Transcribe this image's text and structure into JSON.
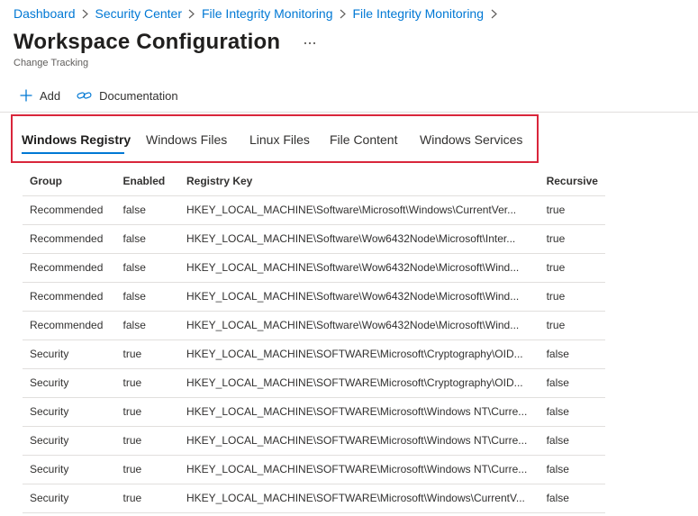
{
  "breadcrumb": [
    "Dashboard",
    "Security Center",
    "File Integrity Monitoring",
    "File Integrity Monitoring"
  ],
  "header": {
    "title": "Workspace Configuration",
    "more_label": "...",
    "subtitle": "Change Tracking"
  },
  "toolbar": {
    "add_label": "Add",
    "documentation_label": "Documentation"
  },
  "tabs": [
    {
      "label": "Windows Registry",
      "active": true
    },
    {
      "label": "Windows Files",
      "active": false
    },
    {
      "label": "Linux Files",
      "active": false
    },
    {
      "label": "File Content",
      "active": false
    },
    {
      "label": "Windows Services",
      "active": false
    }
  ],
  "table": {
    "columns": [
      "Group",
      "Enabled",
      "Registry Key",
      "Recursive"
    ],
    "rows": [
      [
        "Recommended",
        "false",
        "HKEY_LOCAL_MACHINE\\Software\\Microsoft\\Windows\\CurrentVer...",
        "true"
      ],
      [
        "Recommended",
        "false",
        "HKEY_LOCAL_MACHINE\\Software\\Wow6432Node\\Microsoft\\Inter...",
        "true"
      ],
      [
        "Recommended",
        "false",
        "HKEY_LOCAL_MACHINE\\Software\\Wow6432Node\\Microsoft\\Wind...",
        "true"
      ],
      [
        "Recommended",
        "false",
        "HKEY_LOCAL_MACHINE\\Software\\Wow6432Node\\Microsoft\\Wind...",
        "true"
      ],
      [
        "Recommended",
        "false",
        "HKEY_LOCAL_MACHINE\\Software\\Wow6432Node\\Microsoft\\Wind...",
        "true"
      ],
      [
        "Security",
        "true",
        "HKEY_LOCAL_MACHINE\\SOFTWARE\\Microsoft\\Cryptography\\OID...",
        "false"
      ],
      [
        "Security",
        "true",
        "HKEY_LOCAL_MACHINE\\SOFTWARE\\Microsoft\\Cryptography\\OID...",
        "false"
      ],
      [
        "Security",
        "true",
        "HKEY_LOCAL_MACHINE\\SOFTWARE\\Microsoft\\Windows NT\\Curre...",
        "false"
      ],
      [
        "Security",
        "true",
        "HKEY_LOCAL_MACHINE\\SOFTWARE\\Microsoft\\Windows NT\\Curre...",
        "false"
      ],
      [
        "Security",
        "true",
        "HKEY_LOCAL_MACHINE\\SOFTWARE\\Microsoft\\Windows NT\\Curre...",
        "false"
      ],
      [
        "Security",
        "true",
        "HKEY_LOCAL_MACHINE\\SOFTWARE\\Microsoft\\Windows\\CurrentV...",
        "false"
      ]
    ]
  },
  "colors": {
    "link": "#0078d4",
    "tab_highlight_border": "#d9263b",
    "divider": "#e1dfdd"
  },
  "icons": {
    "breadcrumb_separator": "chevron-right-icon",
    "more": "more-icon",
    "add": "plus-icon",
    "documentation": "link-icon"
  }
}
